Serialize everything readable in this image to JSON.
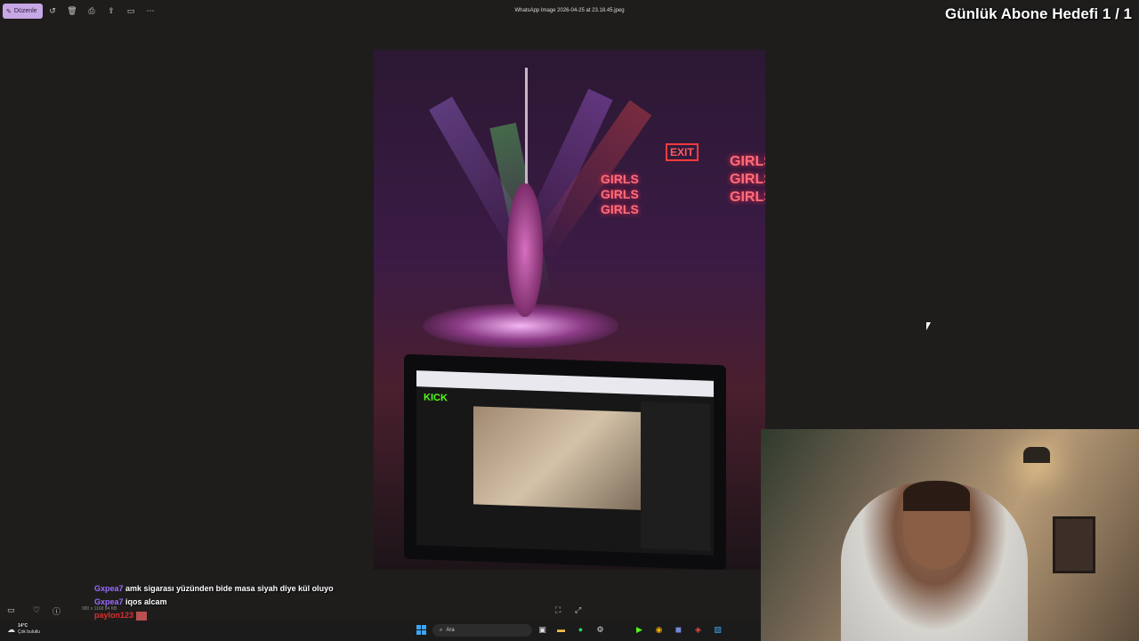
{
  "toolbar": {
    "edit_label": "Düzenle",
    "file_title": "WhatsApp Image 2026-04-25 at 23.18.45.jpeg"
  },
  "overlay": {
    "goal_text": "Günlük Abone Hedefi 1 / 1"
  },
  "image": {
    "neon_left": [
      "GIRLS",
      "GIRLS",
      "GIRLS"
    ],
    "neon_right": [
      "GIRLS",
      "GIRLS",
      "GIRLS"
    ],
    "exit_sign": "EXIT",
    "screen_logo": "KICK"
  },
  "chat": [
    {
      "user": "Gxpea7",
      "message": "amk sigarası yüzünden bide masa siyah diye kül oluyo"
    },
    {
      "user": "Gxpea7",
      "message": "iqos alcam"
    },
    {
      "user": "paylon123",
      "message": ""
    }
  ],
  "bottom": {
    "image_dims": "980 x 1168",
    "file_size": "84 KB"
  },
  "taskbar": {
    "weather_temp": "14°C",
    "weather_desc": "Çok bulutlu",
    "search_placeholder": "Ara"
  },
  "colors": {
    "edit_button_bg": "#c7a7e6",
    "chat_user": "#9b6cff",
    "chat_user_red": "#d93030",
    "kick_green": "#53fc18",
    "windows_blue": "#3da5f4"
  }
}
